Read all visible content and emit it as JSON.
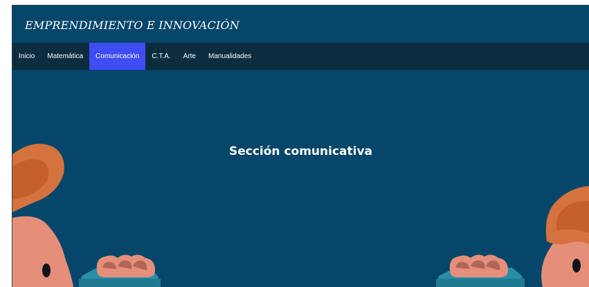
{
  "header": {
    "brand": "EMPRENDIMIENTO E INNOVACIÓN"
  },
  "nav": {
    "items": [
      {
        "label": "Inicio",
        "active": false
      },
      {
        "label": "Matemática",
        "active": false
      },
      {
        "label": "Comunicación",
        "active": true
      },
      {
        "label": "C.T.A.",
        "active": false
      },
      {
        "label": "Arte",
        "active": false
      },
      {
        "label": "Manualidades",
        "active": false
      }
    ]
  },
  "hero": {
    "title": "Sección comunicativa"
  },
  "colors": {
    "header_bg": "#06466b",
    "nav_bg": "#0c2d3f",
    "active_tab": "#3f4cf4",
    "hero_bg": "#05466a"
  }
}
